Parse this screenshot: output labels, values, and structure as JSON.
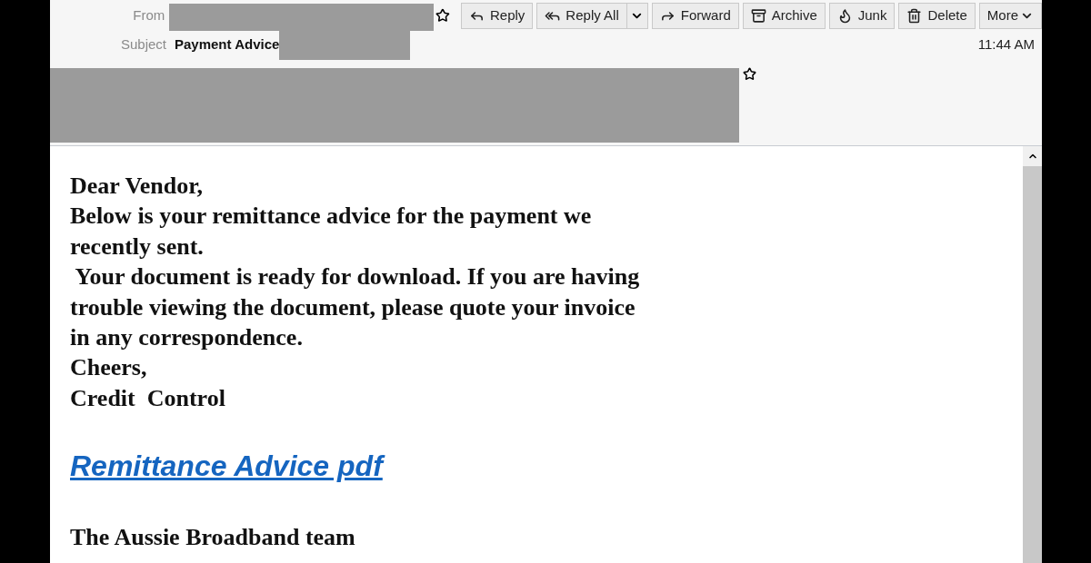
{
  "header": {
    "from_label": "From",
    "subject_label": "Subject",
    "subject": "Payment Advice",
    "time": "11:44 AM",
    "buttons": [
      {
        "kind": "reply",
        "label": "Reply"
      },
      {
        "kind": "reply_all",
        "label": "Reply All"
      },
      {
        "kind": "forward",
        "label": "Forward"
      },
      {
        "kind": "archive",
        "label": "Archive"
      },
      {
        "kind": "junk",
        "label": "Junk"
      },
      {
        "kind": "delete",
        "label": "Delete"
      },
      {
        "kind": "more",
        "label": "More"
      }
    ]
  },
  "body": {
    "lines": [
      "Dear Vendor,",
      "Below is your remittance advice for the payment we",
      "recently sent.",
      " Your document is ready for download. If you are having",
      "trouble viewing the document, please quote your invoice",
      "in any correspondence.",
      "Cheers,",
      "Credit  Control"
    ],
    "link": "Remittance Advice pdf",
    "signature": "The Aussie Broadband team"
  }
}
